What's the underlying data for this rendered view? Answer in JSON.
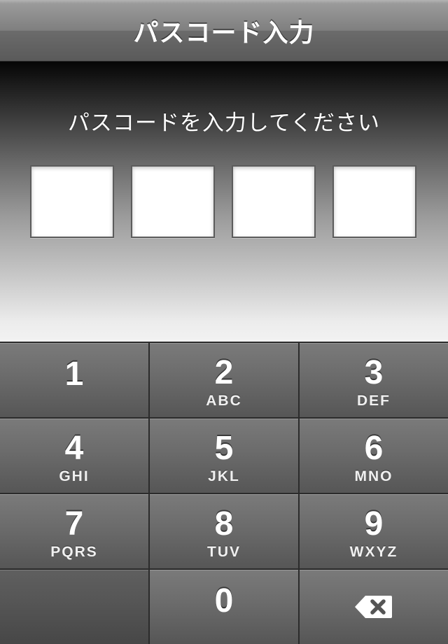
{
  "nav": {
    "title": "パスコード入力"
  },
  "prompt": {
    "text": "パスコードを入力してください"
  },
  "keypad": {
    "keys": [
      {
        "number": "1",
        "letters": ""
      },
      {
        "number": "2",
        "letters": "ABC"
      },
      {
        "number": "3",
        "letters": "DEF"
      },
      {
        "number": "4",
        "letters": "GHI"
      },
      {
        "number": "5",
        "letters": "JKL"
      },
      {
        "number": "6",
        "letters": "MNO"
      },
      {
        "number": "7",
        "letters": "PQRS"
      },
      {
        "number": "8",
        "letters": "TUV"
      },
      {
        "number": "9",
        "letters": "WXYZ"
      },
      {
        "number": "0",
        "letters": ""
      }
    ],
    "backspace_icon": "backspace-icon"
  },
  "colors": {
    "key_text": "#ffffff",
    "digit_box": "#ffffff"
  }
}
